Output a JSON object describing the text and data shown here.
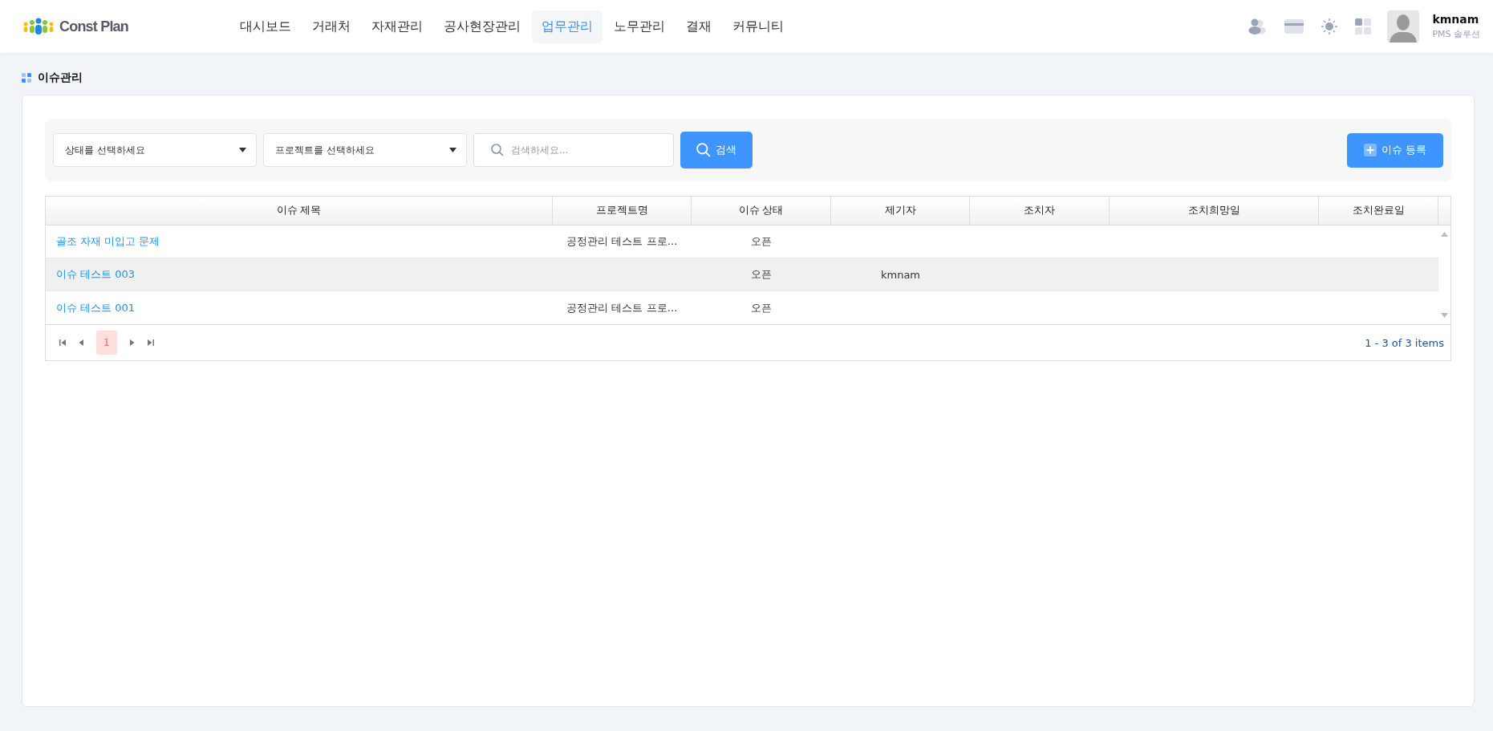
{
  "header": {
    "logo": "Const Plan",
    "nav": [
      {
        "label": "대시보드",
        "selected": false
      },
      {
        "label": "거래처",
        "selected": false
      },
      {
        "label": "자재관리",
        "selected": false
      },
      {
        "label": "공사현장관리",
        "selected": false
      },
      {
        "label": "업무관리",
        "selected": true
      },
      {
        "label": "노무관리",
        "selected": false
      },
      {
        "label": "결재",
        "selected": false
      },
      {
        "label": "커뮤니티",
        "selected": false
      }
    ],
    "user": {
      "name": "kmnam",
      "role": "PMS 솔루션"
    }
  },
  "page_title": "이슈관리",
  "filters": {
    "status_select": "상태를 선택하세요",
    "project_select": "프로젝트를 선택하세요",
    "search": {
      "placeholder": "검색하세요..."
    },
    "search_button": "검색",
    "add_button": "이슈 등록"
  },
  "table": {
    "columns": [
      "이슈 제목",
      "프로젝트명",
      "이슈 상태",
      "제기자",
      "조치자",
      "조치희망일",
      "조치완료일"
    ],
    "rows": [
      {
        "highlighted": false,
        "cells": [
          "골조 자재 미입고 문제",
          "공정관리 테스트 프로…",
          "오픈",
          "",
          "",
          "",
          ""
        ]
      },
      {
        "highlighted": true,
        "cells": [
          "이슈 테스트 003",
          "",
          "오픈",
          "kmnam",
          "",
          "",
          ""
        ]
      },
      {
        "highlighted": false,
        "cells": [
          "이슈 테스트 001",
          "공정관리 테스트 프로…",
          "오픈",
          "",
          "",
          "",
          ""
        ]
      }
    ]
  },
  "pager": {
    "pages": [
      {
        "label": "1",
        "selected": true
      }
    ],
    "info": "1 - 3 of 3 items"
  }
}
